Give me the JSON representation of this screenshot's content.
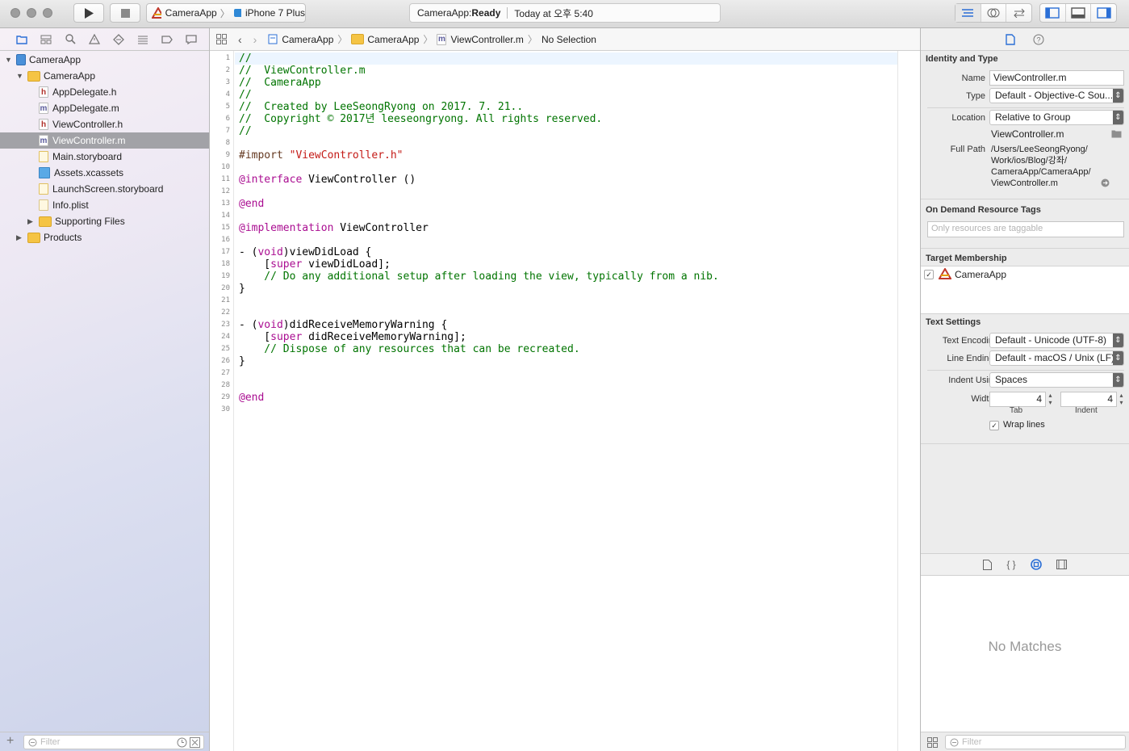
{
  "toolbar": {
    "run_icon": "play-icon",
    "stop_icon": "stop-icon",
    "scheme": "CameraApp",
    "device": "iPhone 7 Plus",
    "activity_status_prefix": "CameraApp: ",
    "activity_status": "Ready",
    "activity_time": "Today at 오후 5:40"
  },
  "navigator": {
    "tabs": [
      "folder-icon",
      "hierarchy-icon",
      "search-icon",
      "warning-icon",
      "test-icon",
      "debug-icon",
      "breakpoint-icon",
      "report-icon"
    ],
    "items": [
      {
        "label": "CameraApp",
        "kind": "project",
        "indent": 0,
        "expanded": true,
        "selected": false
      },
      {
        "label": "CameraApp",
        "kind": "folder",
        "indent": 1,
        "expanded": true,
        "selected": false
      },
      {
        "label": "AppDelegate.h",
        "kind": "h",
        "indent": 2,
        "selected": false
      },
      {
        "label": "AppDelegate.m",
        "kind": "m",
        "indent": 2,
        "selected": false
      },
      {
        "label": "ViewController.h",
        "kind": "h",
        "indent": 2,
        "selected": false
      },
      {
        "label": "ViewController.m",
        "kind": "m",
        "indent": 2,
        "selected": true
      },
      {
        "label": "Main.storyboard",
        "kind": "storyboard",
        "indent": 2,
        "selected": false
      },
      {
        "label": "Assets.xcassets",
        "kind": "assets",
        "indent": 2,
        "selected": false
      },
      {
        "label": "LaunchScreen.storyboard",
        "kind": "storyboard",
        "indent": 2,
        "selected": false
      },
      {
        "label": "Info.plist",
        "kind": "plist",
        "indent": 2,
        "selected": false
      },
      {
        "label": "Supporting Files",
        "kind": "folder",
        "indent": 2,
        "collapsed": true,
        "selected": false
      },
      {
        "label": "Products",
        "kind": "folder",
        "indent": 1,
        "collapsed": true,
        "selected": false
      }
    ],
    "filter_placeholder": "Filter"
  },
  "jumpbar": {
    "crumbs": [
      "CameraApp",
      "CameraApp",
      "ViewController.m",
      "No Selection"
    ]
  },
  "editor": {
    "lines": [
      [
        [
          "c",
          "//"
        ]
      ],
      [
        [
          "c",
          "//  ViewController.m"
        ]
      ],
      [
        [
          "c",
          "//  CameraApp"
        ]
      ],
      [
        [
          "c",
          "//"
        ]
      ],
      [
        [
          "c",
          "//  Created by LeeSeongRyong on 2017. 7. 21.."
        ]
      ],
      [
        [
          "c",
          "//  Copyright © 2017년 leeseongryong. All rights reserved."
        ]
      ],
      [
        [
          "c",
          "//"
        ]
      ],
      [],
      [
        [
          "p",
          "#import "
        ],
        [
          "s",
          "\"ViewController.h\""
        ]
      ],
      [],
      [
        [
          "k",
          "@interface"
        ],
        [
          "n",
          " ViewController ()"
        ]
      ],
      [],
      [
        [
          "k",
          "@end"
        ]
      ],
      [],
      [
        [
          "k",
          "@implementation"
        ],
        [
          "n",
          " ViewController"
        ]
      ],
      [],
      [
        [
          "n",
          "- ("
        ],
        [
          "k",
          "void"
        ],
        [
          "n",
          ")viewDidLoad {"
        ]
      ],
      [
        [
          "n",
          "    ["
        ],
        [
          "k",
          "super"
        ],
        [
          "n",
          " viewDidLoad];"
        ]
      ],
      [
        [
          "c",
          "    // Do any additional setup after loading the view, typically from a nib."
        ]
      ],
      [
        [
          "n",
          "}"
        ]
      ],
      [],
      [],
      [
        [
          "n",
          "- ("
        ],
        [
          "k",
          "void"
        ],
        [
          "n",
          ")didReceiveMemoryWarning {"
        ]
      ],
      [
        [
          "n",
          "    ["
        ],
        [
          "k",
          "super"
        ],
        [
          "n",
          " didReceiveMemoryWarning];"
        ]
      ],
      [
        [
          "c",
          "    // Dispose of any resources that can be recreated."
        ]
      ],
      [
        [
          "n",
          "}"
        ]
      ],
      [],
      [],
      [
        [
          "k",
          "@end"
        ]
      ],
      []
    ]
  },
  "inspector": {
    "tabs": [
      "file-icon",
      "help-icon"
    ],
    "identity": {
      "header": "Identity and Type",
      "name_label": "Name",
      "name_value": "ViewController.m",
      "type_label": "Type",
      "type_value": "Default - Objective-C Sou...",
      "location_label": "Location",
      "location_value": "Relative to Group",
      "location_file": "ViewController.m",
      "fullpath_label": "Full Path",
      "fullpath_lines": [
        "/Users/LeeSeongRyong/",
        "Work/ios/Blog/강좌/",
        "CameraApp/CameraApp/",
        "ViewController.m"
      ]
    },
    "ondemand": {
      "header": "On Demand Resource Tags",
      "placeholder": "Only resources are taggable"
    },
    "target": {
      "header": "Target Membership",
      "item": "CameraApp",
      "checked": true
    },
    "text": {
      "header": "Text Settings",
      "encoding_label": "Text Encoding",
      "encoding_value": "Default - Unicode (UTF-8)",
      "endings_label": "Line Endings",
      "endings_value": "Default - macOS / Unix (LF)",
      "indent_label": "Indent Using",
      "indent_value": "Spaces",
      "widths_label": "Widths",
      "tab_value": "4",
      "indent_width_value": "4",
      "tab_caption": "Tab",
      "indent_caption": "Indent",
      "wrap_label": "Wrap lines",
      "wrap_checked": true
    },
    "library_tabs": [
      "file-template-icon",
      "code-snippet-icon",
      "object-library-icon",
      "media-library-icon"
    ],
    "library_empty": "No Matches",
    "filter_placeholder": "Filter"
  }
}
